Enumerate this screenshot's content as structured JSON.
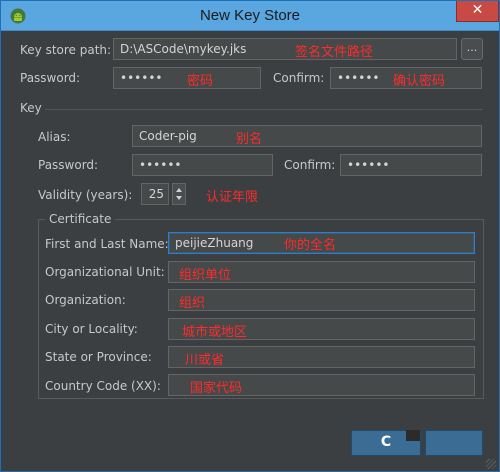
{
  "window": {
    "title": "New Key Store",
    "close_glyph": "✕",
    "app_icon": "android-icon",
    "title_color": "#5aa6e0"
  },
  "keystore": {
    "path_label": "Key store path:",
    "path_value": "D:\\ASCode\\mykey.jks",
    "path_note": "签名文件路径",
    "browse_label": "...",
    "password_label": "Password:",
    "password_value": "••••••",
    "password_note": "密码",
    "confirm_label": "Confirm:",
    "confirm_value": "••••••",
    "confirm_note": "确认密码"
  },
  "key": {
    "section_label": "Key",
    "alias_label": "Alias:",
    "alias_value": "Coder-pig",
    "alias_note": "别名",
    "password_label": "Password:",
    "password_value": "••••••",
    "confirm_label": "Confirm:",
    "confirm_value": "••••••",
    "validity_label": "Validity (years):",
    "validity_value": "25",
    "validity_note": "认证年限"
  },
  "certificate": {
    "section_label": "Certificate",
    "name_label": "First and Last Name:",
    "name_value": "peijieZhuang",
    "name_note": "你的全名",
    "unit_label": "Organizational Unit:",
    "unit_note": "组织单位",
    "org_label": "Organization:",
    "org_note": "组织",
    "city_label": "City or Locality:",
    "city_note": "城市或地区",
    "state_label": "State or Province:",
    "state_note": "川或省",
    "country_label": "Country Code (XX):",
    "country_note": "国家代码"
  },
  "buttons": {
    "ok_label": "C"
  },
  "colors": {
    "accent_red": "#ff2b2b",
    "dialog_bg": "#3c3f41",
    "button_blue": "#3b6d94"
  }
}
